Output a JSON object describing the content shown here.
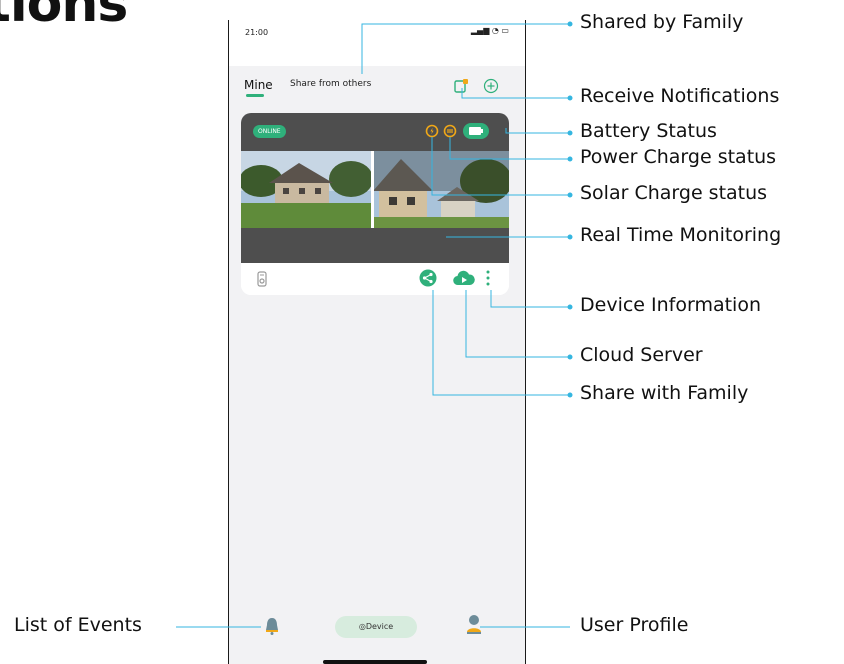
{
  "heading": "tions",
  "phone": {
    "time": "21:00",
    "signal_icons": "▂▄▆ ◔ ▭",
    "tabs": [
      {
        "label": "Mine",
        "active": true
      },
      {
        "label": "Share from others",
        "active": false
      }
    ],
    "card": {
      "status_badge": "ONLINE"
    },
    "nav": {
      "device_label": "Device"
    }
  },
  "callouts": {
    "shared_by_family": "Shared by Family",
    "receive_notifications": "Receive Notifications",
    "battery_status": "Battery Status",
    "power_charge_status": "Power Charge status",
    "solar_charge_status": "Solar Charge status",
    "real_time_monitoring": "Real Time Monitoring",
    "device_information": "Device Information",
    "cloud_server": "Cloud Server",
    "share_with_family": "Share with Family",
    "list_of_events": "List of Events",
    "user_profile": "User Profile"
  },
  "colors": {
    "accent_green": "#2fb07b",
    "callout_line": "#35b6e0",
    "solar_orange": "#f0a818",
    "card_dark": "#4e4e4e"
  }
}
